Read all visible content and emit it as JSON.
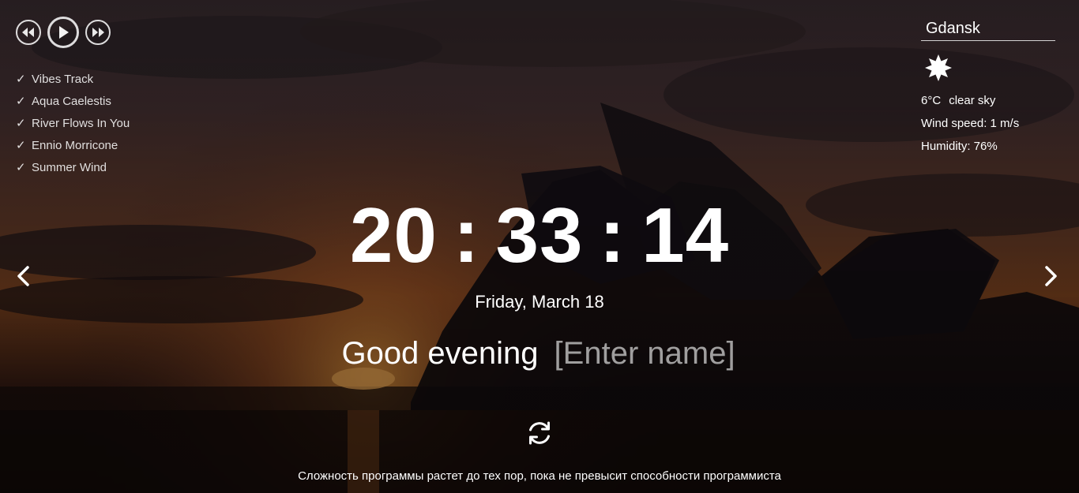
{
  "player": {
    "prev_icon": "rewind-icon",
    "play_icon": "play-icon",
    "next_icon": "fast-forward-icon"
  },
  "playlist": [
    {
      "check": "✓",
      "title": "Vibes Track"
    },
    {
      "check": "✓",
      "title": "Aqua Caelestis"
    },
    {
      "check": "✓",
      "title": "River Flows In You"
    },
    {
      "check": "✓",
      "title": "Ennio Morricone"
    },
    {
      "check": "✓",
      "title": "Summer Wind"
    }
  ],
  "weather": {
    "city": "Gdansk",
    "icon": "sun-icon",
    "temperature": "6°C",
    "description": "clear sky",
    "wind": "Wind speed: 1 m/s",
    "humidity": "Humidity: 76%"
  },
  "clock": {
    "hours": "20",
    "minutes": "33",
    "seconds": "14",
    "separator": ":"
  },
  "date": "Friday, March 18",
  "greeting": {
    "text": "Good evening",
    "name_value": "[Enter name]"
  },
  "quote": "Сложность программы растет до тех пор, пока не превысит способности программиста",
  "colors": {
    "text": "#ffffff",
    "placeholder": "#d2d2d2"
  }
}
